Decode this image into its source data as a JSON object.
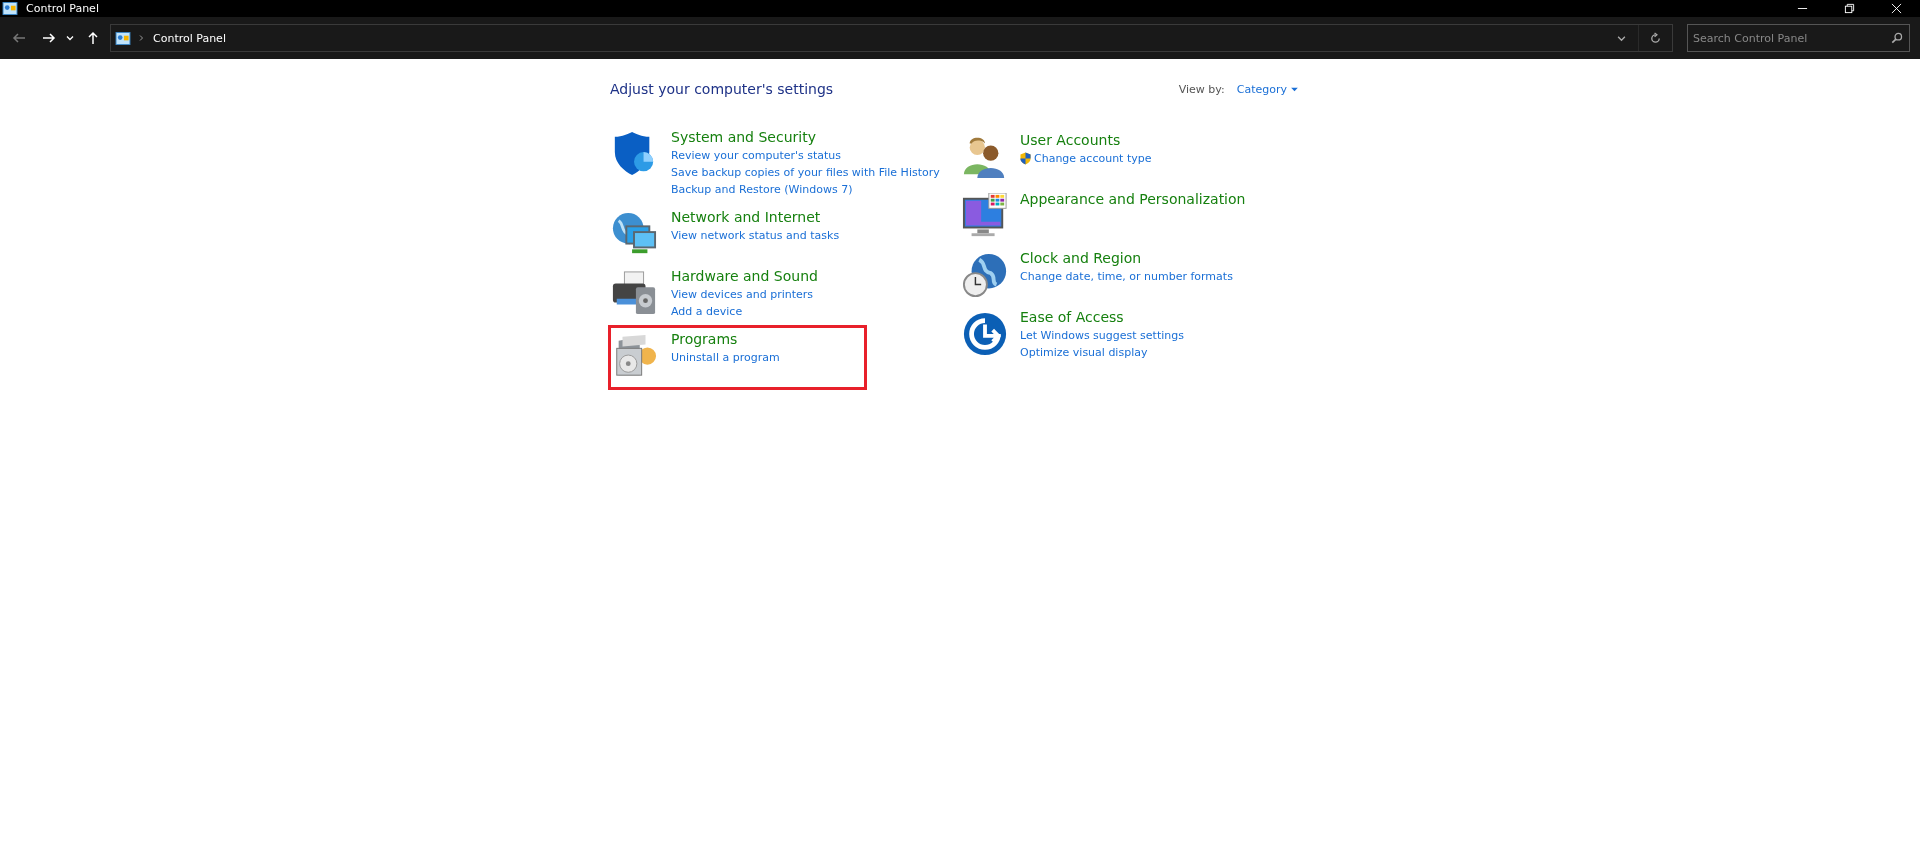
{
  "window": {
    "title": "Control Panel"
  },
  "nav": {
    "back": {
      "disabled": true
    },
    "forward": {
      "disabled": false
    }
  },
  "address": {
    "location": "Control Panel"
  },
  "search": {
    "placeholder": "Search Control Panel"
  },
  "heading": "Adjust your computer's settings",
  "view_by": {
    "label": "View by:",
    "value": "Category"
  },
  "columns": [
    [
      {
        "title": "System and Security",
        "highlighted": false,
        "links": [
          {
            "text": "Review your computer's status",
            "shield": false
          },
          {
            "text": "Save backup copies of your files with File History",
            "shield": false
          },
          {
            "text": "Backup and Restore (Windows 7)",
            "shield": false
          }
        ]
      },
      {
        "title": "Network and Internet",
        "highlighted": false,
        "links": [
          {
            "text": "View network status and tasks",
            "shield": false
          }
        ]
      },
      {
        "title": "Hardware and Sound",
        "highlighted": false,
        "links": [
          {
            "text": "View devices and printers",
            "shield": false
          },
          {
            "text": "Add a device",
            "shield": false
          }
        ]
      },
      {
        "title": "Programs",
        "highlighted": true,
        "links": [
          {
            "text": "Uninstall a program",
            "shield": false
          }
        ]
      }
    ],
    [
      {
        "title": "User Accounts",
        "highlighted": false,
        "links": [
          {
            "text": "Change account type",
            "shield": true
          }
        ]
      },
      {
        "title": "Appearance and Personalization",
        "highlighted": false
      },
      {
        "title": "Clock and Region",
        "highlighted": false,
        "links": [
          {
            "text": "Change date, time, or number formats",
            "shield": false
          }
        ]
      },
      {
        "title": "Ease of Access",
        "highlighted": false,
        "links": [
          {
            "text": "Let Windows suggest settings",
            "shield": false
          },
          {
            "text": "Optimize visual display",
            "shield": false
          }
        ]
      }
    ]
  ]
}
